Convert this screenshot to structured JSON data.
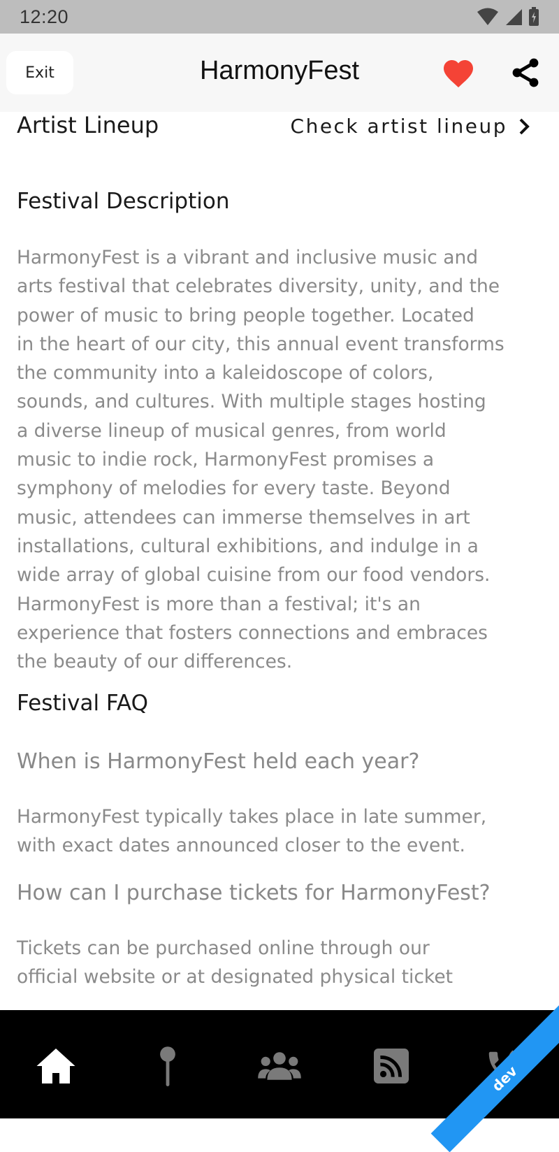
{
  "status_bar": {
    "time": "12:20"
  },
  "app_bar": {
    "exit_label": "Exit",
    "title": "HarmonyFest"
  },
  "lineup": {
    "title": "Artist Lineup",
    "link_label": "Check artist lineup"
  },
  "description": {
    "heading": "Festival Description",
    "lines": [
      "HarmonyFest is a vibrant and inclusive music and",
      "arts festival that celebrates diversity, unity, and the",
      "power of music to bring people together. Located",
      "in the heart of our city, this annual event transforms",
      "the community into a kaleidoscope of colors,",
      "sounds, and cultures. With multiple stages hosting",
      "a diverse lineup of musical genres, from world",
      "music to indie rock, HarmonyFest promises a",
      "symphony of melodies for every taste. Beyond",
      "music, attendees can immerse themselves in art",
      "installations, cultural exhibitions, and indulge in a",
      "wide array of global cuisine from our food vendors.",
      "HarmonyFest is more than a festival; it's an",
      "experience that fosters connections and embraces",
      "the beauty of our differences."
    ]
  },
  "faq": {
    "heading": "Festival FAQ",
    "items": [
      {
        "question": "When is HarmonyFest held each year?",
        "answer_lines": [
          "HarmonyFest typically takes place in late summer,",
          "with exact dates announced closer to the event."
        ]
      },
      {
        "question": "How can I purchase tickets for HarmonyFest?",
        "answer_lines": [
          "Tickets can be purchased online through our",
          "official website or at designated physical ticket"
        ]
      }
    ]
  },
  "bottom_nav": {
    "items": [
      {
        "icon": "home-icon"
      },
      {
        "icon": "map-pin-icon"
      },
      {
        "icon": "people-icon"
      },
      {
        "icon": "rss-feed-icon"
      },
      {
        "icon": "phone-icon"
      }
    ]
  },
  "debug_banner": "dev",
  "colors": {
    "heart": "#f44336",
    "nav_active": "#ffffff",
    "nav_inactive": "#7a7a7a",
    "banner": "#2196f3"
  }
}
